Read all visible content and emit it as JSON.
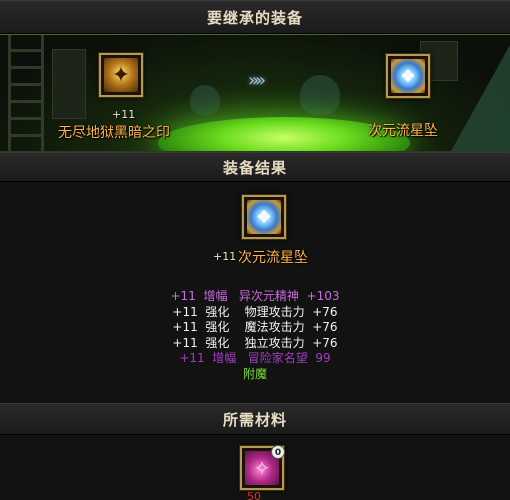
{
  "sections": {
    "inherit_title": "要继承的装备",
    "result_title": "装备结果",
    "material_title": "所需材料"
  },
  "source_item": {
    "enhance": "+11",
    "name": "无尽地狱黑暗之印",
    "icon": "dark-seal-icon"
  },
  "target_item": {
    "name": "次元流星坠",
    "icon": "dimension-meteor-pendant-icon"
  },
  "transfer_arrows": "»»",
  "result_item": {
    "enhance": "+11",
    "name": "次元流星坠",
    "icon": "dimension-meteor-pendant-icon"
  },
  "result_stats": [
    {
      "text": "+11  增幅   异次元精神  +103",
      "style": "magenta"
    },
    {
      "text": "+11  强化    物理攻击力  +76",
      "style": "white"
    },
    {
      "text": "+11  强化    魔法攻击力  +76",
      "style": "white"
    },
    {
      "text": "+11  强化    独立攻击力  +76",
      "style": "white"
    },
    {
      "text": "+11  增幅   冒险家名望  99",
      "style": "dark"
    },
    {
      "text": "附魔",
      "style": "green"
    }
  ],
  "material": {
    "icon": "magenta-crystal-icon",
    "badge": "0",
    "count": "50"
  },
  "colors": {
    "item_name": "#ffb24a",
    "amplify": "#c86adf",
    "reinforce": "#f2f2f2",
    "enchant": "#7adf3a",
    "pool_glow": "#6bdc1e"
  }
}
